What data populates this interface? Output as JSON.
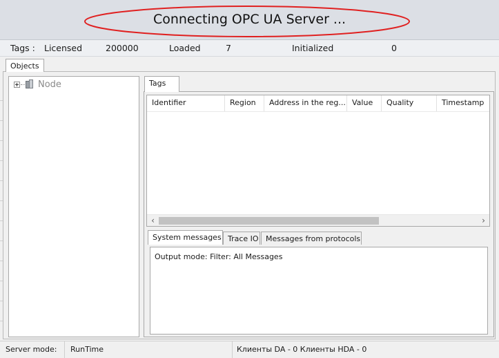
{
  "banner": {
    "title": "Connecting OPC UA Server ...",
    "highlight_color": "#e02020"
  },
  "status": {
    "tags_label": "Tags :",
    "licensed_label": "Licensed",
    "licensed_value": "200000",
    "loaded_label": "Loaded",
    "loaded_value": "7",
    "initialized_label": "Initialized",
    "initialized_value": "0"
  },
  "objects_tab": {
    "label": "Objects"
  },
  "tree": {
    "root_label": "Node",
    "root_icon": "server-node-icon"
  },
  "tags_tab": {
    "label": "Tags"
  },
  "tags_grid": {
    "columns": [
      "Identifier",
      "Region",
      "Address in the reg...",
      "Value",
      "Quality",
      "Timestamp"
    ]
  },
  "scrollbar": {
    "left_arrow": "‹",
    "right_arrow": "›"
  },
  "message_tabs": [
    "System messages",
    "Trace IO",
    "Messages from protocols"
  ],
  "messages": {
    "output_mode": "Output mode: Filter: All Messages"
  },
  "footer": {
    "server_mode_label": "Server mode:",
    "server_mode_value": "RunTime",
    "clients": "Клиенты DA - 0 Клиенты HDA - 0"
  }
}
